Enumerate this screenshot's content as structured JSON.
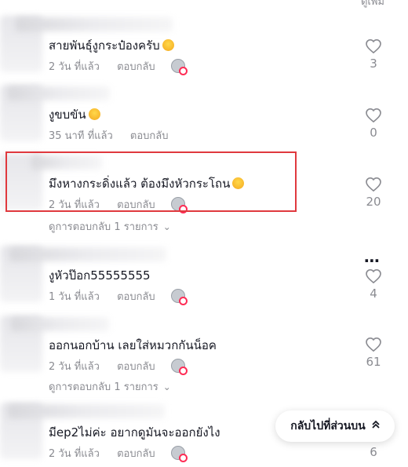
{
  "header": {
    "cut_text": "ดูเพิ่ม"
  },
  "comments": [
    {
      "text": "สายพันธุ์งูกระป๋องครับ",
      "time": "2 วัน ที่แล้ว",
      "reply": "ตอบกลับ",
      "likes": "3"
    },
    {
      "text": "งูขบขัน",
      "time": "35 นาที ที่แล้ว",
      "reply": "ตอบกลับ",
      "likes": "0"
    },
    {
      "text": "มึงหางกระดิ่งแล้ว ต้องมึงหัวกระโถน",
      "time": "2 วัน ที่แล้ว",
      "reply": "ตอบกลับ",
      "likes": "20",
      "view_replies": "ดูการตอบกลับ 1 รายการ"
    },
    {
      "text": "งูหัวป๊อก55555555",
      "time": "1 วัน ที่แล้ว",
      "reply": "ตอบกลับ",
      "likes": "4"
    },
    {
      "text": "ออกนอกบ้าน เลยใส่หมวกกันน็อค",
      "time": "2 วัน ที่แล้ว",
      "reply": "ตอบกลับ",
      "likes": "61",
      "view_replies": "ดูการตอบกลับ 1 รายการ"
    },
    {
      "text": "มีep2ไม่ค่ะ อยากดูมันจะออกยังไง",
      "time": "2 วัน ที่แล้ว",
      "reply": "ตอบกลับ",
      "likes": "6"
    }
  ],
  "back_to_top": {
    "label": "กลับไปที่ส่วนบน"
  },
  "colors": {
    "highlight": "#e0393e",
    "muted": "#8a8b91",
    "text": "#161823",
    "badge": "#fe2c55"
  }
}
